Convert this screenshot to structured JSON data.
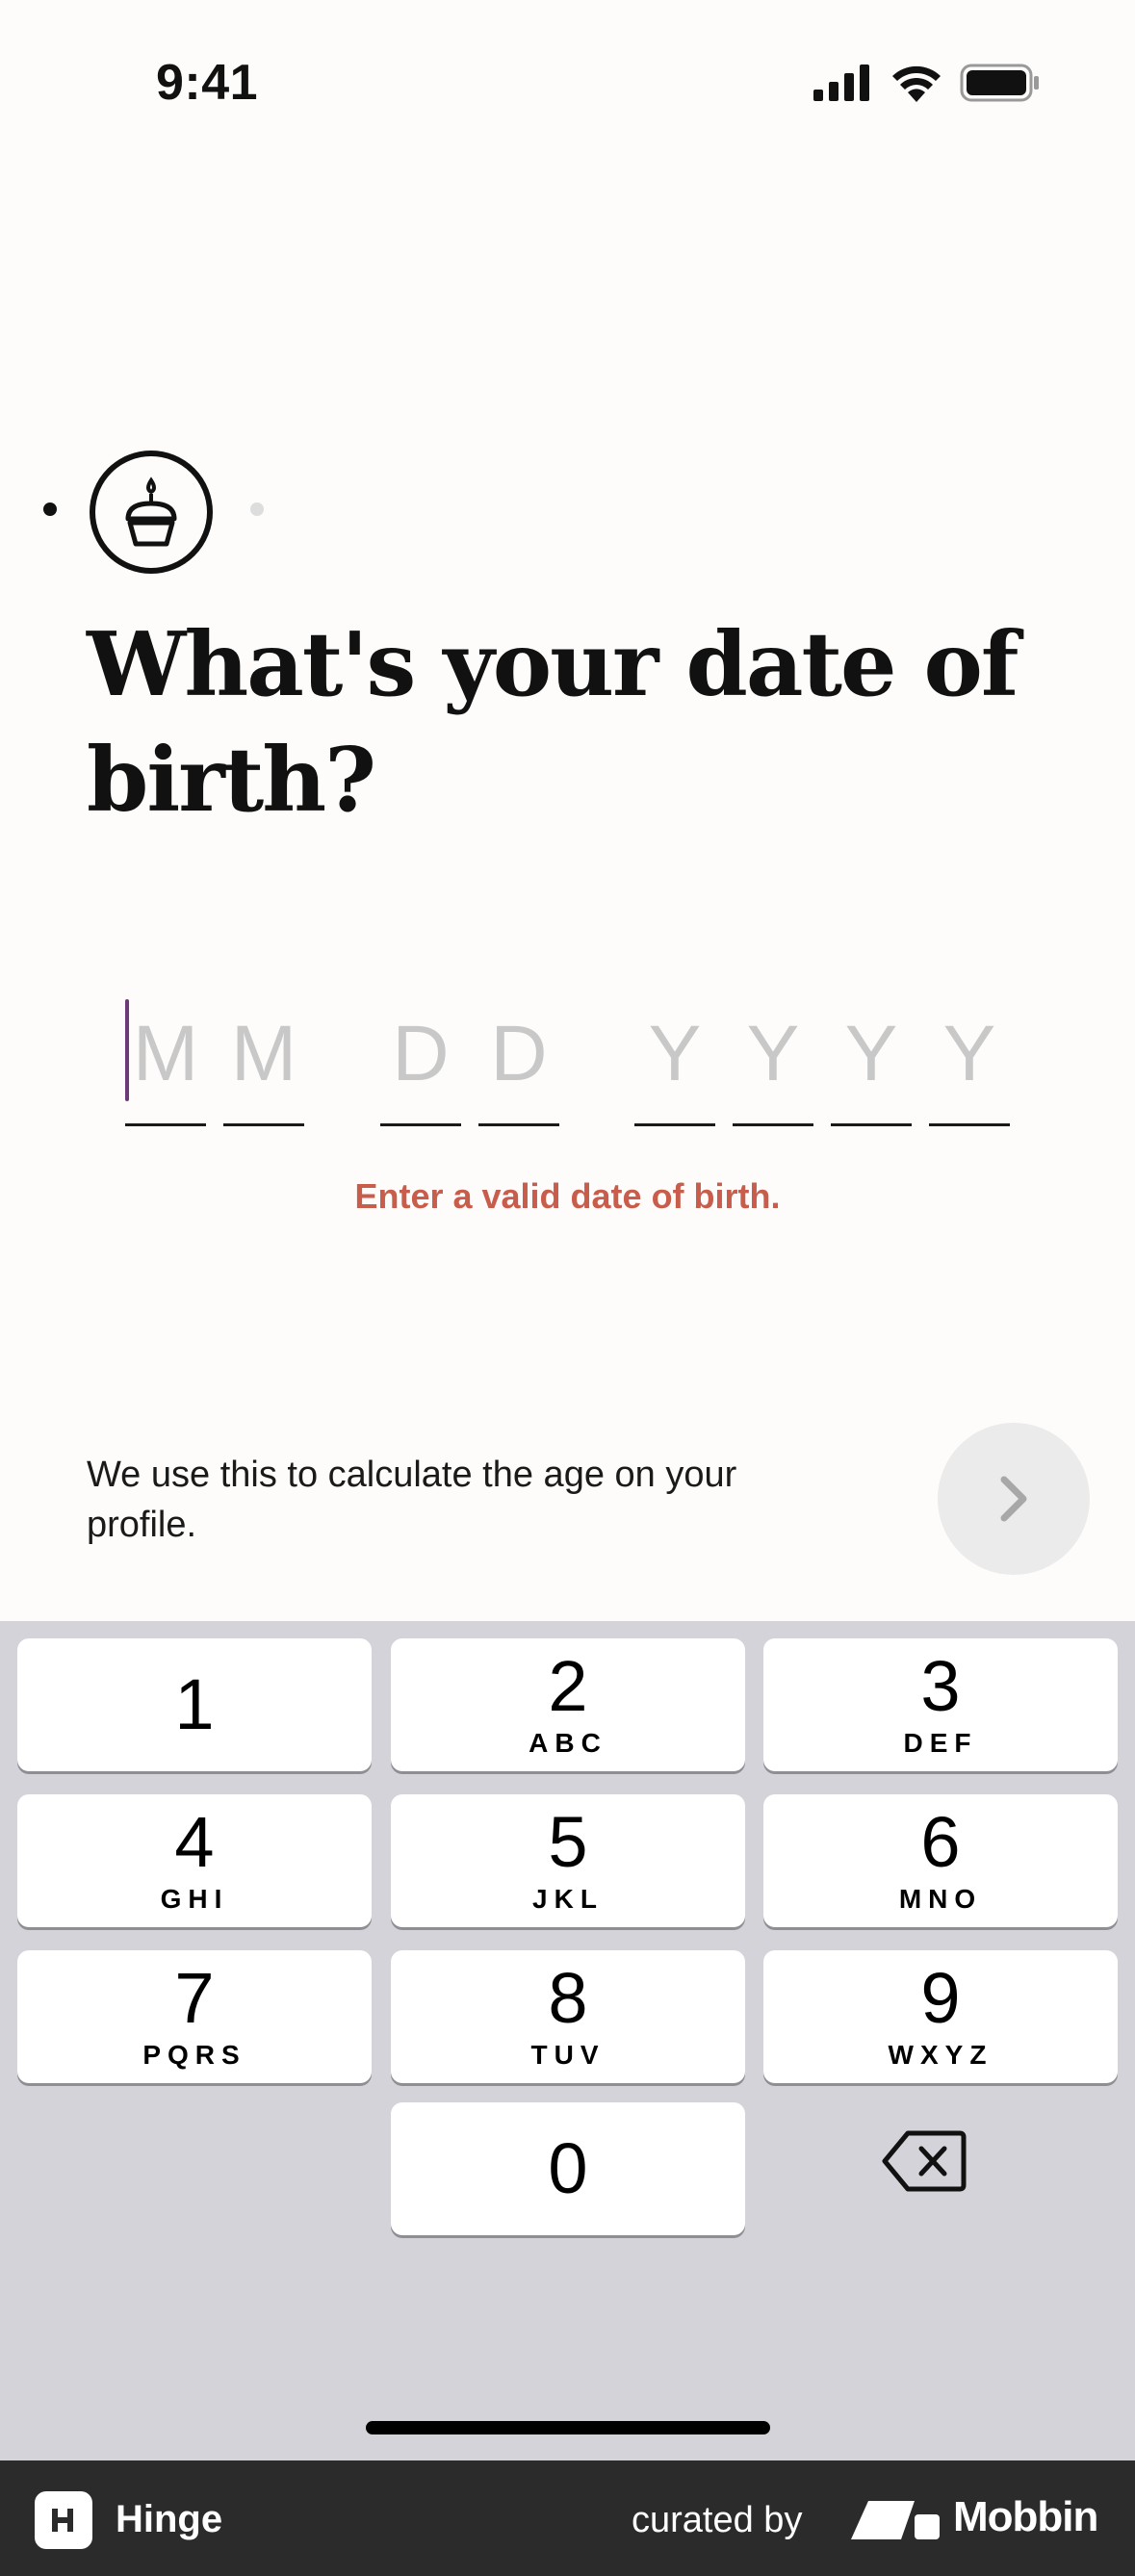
{
  "status_bar": {
    "time": "9:41"
  },
  "question": {
    "title": "What's your date of birth?"
  },
  "dob": {
    "placeholders": [
      "M",
      "M",
      "D",
      "D",
      "Y",
      "Y",
      "Y",
      "Y"
    ],
    "error": "Enter a valid date of birth."
  },
  "hint": "We use this to calculate the age on your profile.",
  "keyboard": {
    "keys": [
      {
        "num": "1",
        "letters": ""
      },
      {
        "num": "2",
        "letters": "ABC"
      },
      {
        "num": "3",
        "letters": "DEF"
      },
      {
        "num": "4",
        "letters": "GHI"
      },
      {
        "num": "5",
        "letters": "JKL"
      },
      {
        "num": "6",
        "letters": "MNO"
      },
      {
        "num": "7",
        "letters": "PQRS"
      },
      {
        "num": "8",
        "letters": "TUV"
      },
      {
        "num": "9",
        "letters": "WXYZ"
      },
      {
        "num": "0",
        "letters": ""
      }
    ]
  },
  "footer": {
    "app_name": "Hinge",
    "curated_by": "curated by",
    "brand": "Mobbin"
  },
  "colors": {
    "error": "#c85d4b",
    "cursor": "#6b3a78",
    "background": "#fdfcfa",
    "keyboard": "#d3d3d9"
  }
}
